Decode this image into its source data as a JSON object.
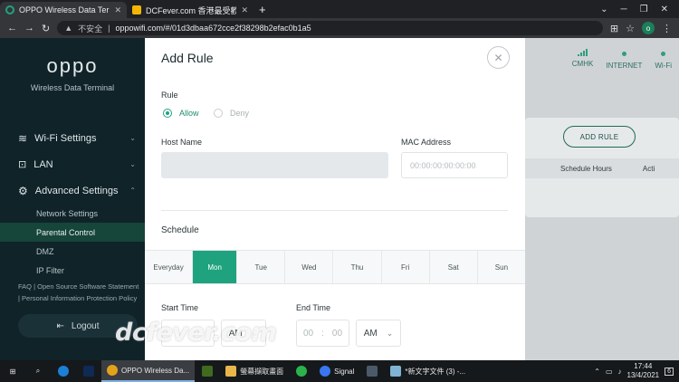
{
  "browser": {
    "tabs": [
      {
        "title": "OPPO Wireless Data Terminal",
        "active": true
      },
      {
        "title": "DCFever.com 香港最受歡迎數碼...",
        "active": false
      }
    ],
    "insecure_label": "不安全",
    "url": "oppowifi.com/#/01d3dbaa672cce2f38298b2efac0b1a5",
    "profile_initial": "o"
  },
  "sidebar": {
    "logo": "oppo",
    "subtitle": "Wireless Data Terminal",
    "items": [
      {
        "label": "Wi-Fi Settings"
      },
      {
        "label": "LAN"
      },
      {
        "label": "Advanced Settings"
      }
    ],
    "subitems": [
      {
        "label": "Network Settings"
      },
      {
        "label": "Parental Control"
      },
      {
        "label": "DMZ"
      },
      {
        "label": "IP Filter"
      }
    ],
    "legal": {
      "faq": "FAQ",
      "oss": "Open Source Software Statement",
      "privacy": "Personal Information Protection Policy"
    },
    "logout": "Logout"
  },
  "status": {
    "carrier": "CMHK",
    "internet": "INTERNET",
    "wifi": "Wi-Fi"
  },
  "background": {
    "add_rule": "ADD RULE",
    "col_schedule": "Schedule Hours",
    "col_action": "Acti"
  },
  "modal": {
    "title": "Add Rule",
    "rule_label": "Rule",
    "allow": "Allow",
    "deny": "Deny",
    "host_label": "Host Name",
    "host_value": "",
    "mac_label": "MAC Address",
    "mac_placeholder": "00:00:00:00:00:00",
    "schedule_label": "Schedule",
    "days": [
      "Everyday",
      "Mon",
      "Tue",
      "Wed",
      "Thu",
      "Fri",
      "Sat",
      "Sun"
    ],
    "active_day": "Mon",
    "start_label": "Start Time",
    "end_label": "End Time",
    "start_ampm": "AM",
    "end_hour": "00",
    "end_minute": "00",
    "end_ampm": "AM"
  },
  "watermark": "dcfever.com",
  "taskbar": {
    "apps": [
      {
        "label": "OPPO Wireless Da..."
      },
      {
        "label": "螢幕擷取畫面"
      },
      {
        "label": "Signal"
      },
      {
        "label": "*新文字文件 (3) -..."
      }
    ],
    "time": "17:44",
    "date": "13/4/2021",
    "notifications": "6"
  }
}
